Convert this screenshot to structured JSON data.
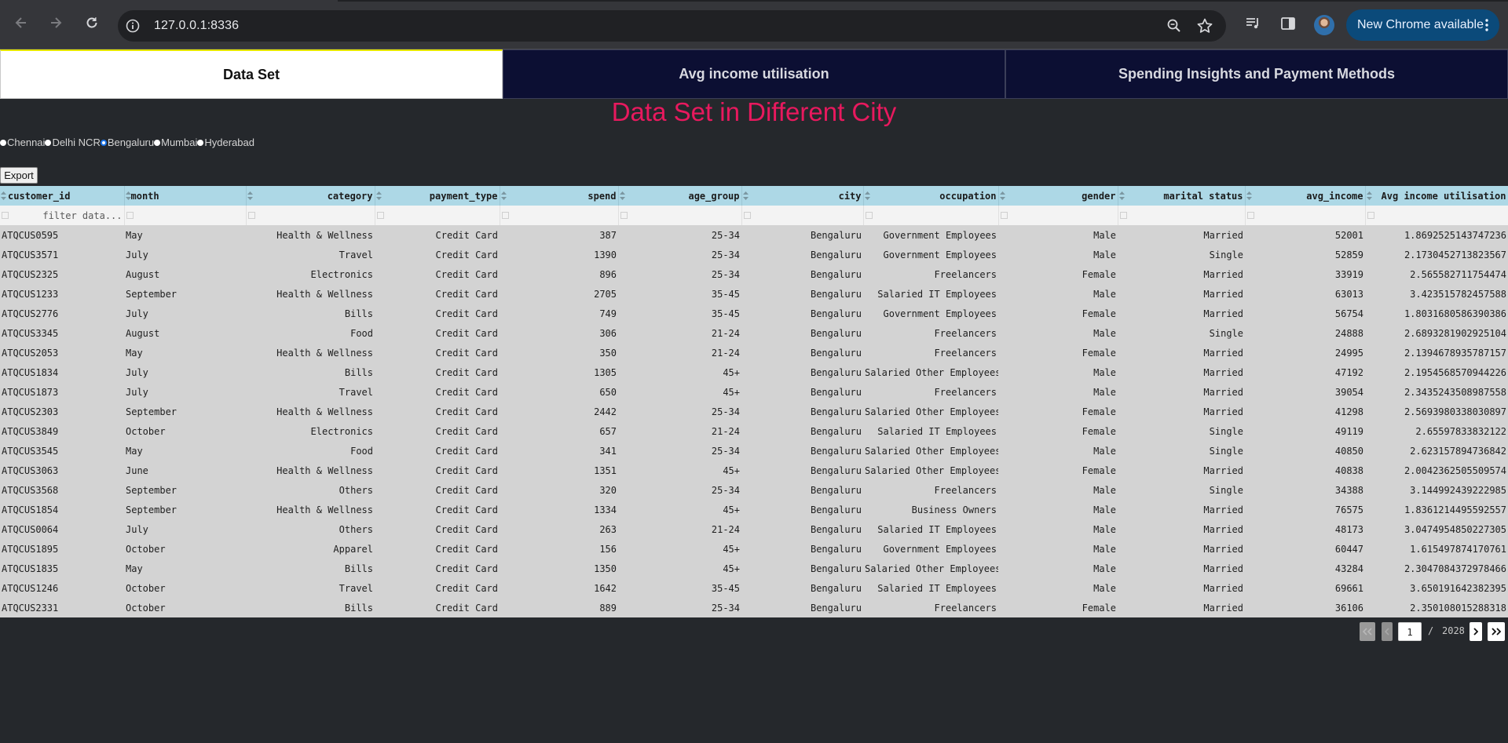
{
  "browser": {
    "url": "127.0.0.1:8336",
    "update_button": "New Chrome available"
  },
  "tabs": [
    {
      "label": "Data Set",
      "selected": true
    },
    {
      "label": "Avg income utilisation",
      "selected": false
    },
    {
      "label": "Spending Insights and Payment Methods",
      "selected": false
    }
  ],
  "title": "Data Set in Different City",
  "cities": [
    {
      "label": "Chennai",
      "selected": false
    },
    {
      "label": "Delhi NCR",
      "selected": false
    },
    {
      "label": "Bengaluru",
      "selected": true
    },
    {
      "label": "Mumbai",
      "selected": false
    },
    {
      "label": "Hyderabad",
      "selected": false
    }
  ],
  "export_label": "Export",
  "table": {
    "columns": [
      "customer_id",
      "month",
      "category",
      "payment_type",
      "spend",
      "age_group",
      "city",
      "occupation",
      "gender",
      "marital status",
      "avg_income",
      "Avg income utilisation"
    ],
    "filter_placeholder": "filter data...",
    "rows": [
      [
        "ATQCUS0595",
        "May",
        "Health & Wellness",
        "Credit Card",
        "387",
        "25-34",
        "Bengaluru",
        "Government Employees",
        "Male",
        "Married",
        "52001",
        "1.8692525143747236"
      ],
      [
        "ATQCUS3571",
        "July",
        "Travel",
        "Credit Card",
        "1390",
        "25-34",
        "Bengaluru",
        "Government Employees",
        "Male",
        "Single",
        "52859",
        "2.1730452713823567"
      ],
      [
        "ATQCUS2325",
        "August",
        "Electronics",
        "Credit Card",
        "896",
        "25-34",
        "Bengaluru",
        "Freelancers",
        "Female",
        "Married",
        "33919",
        "2.565582711754474"
      ],
      [
        "ATQCUS1233",
        "September",
        "Health & Wellness",
        "Credit Card",
        "2705",
        "35-45",
        "Bengaluru",
        "Salaried IT Employees",
        "Male",
        "Married",
        "63013",
        "3.423515782457588"
      ],
      [
        "ATQCUS2776",
        "July",
        "Bills",
        "Credit Card",
        "749",
        "35-45",
        "Bengaluru",
        "Government Employees",
        "Female",
        "Married",
        "56754",
        "1.8031680586390386"
      ],
      [
        "ATQCUS3345",
        "August",
        "Food",
        "Credit Card",
        "306",
        "21-24",
        "Bengaluru",
        "Freelancers",
        "Male",
        "Single",
        "24888",
        "2.6893281902925104"
      ],
      [
        "ATQCUS2053",
        "May",
        "Health & Wellness",
        "Credit Card",
        "350",
        "21-24",
        "Bengaluru",
        "Freelancers",
        "Female",
        "Married",
        "24995",
        "2.1394678935787157"
      ],
      [
        "ATQCUS1834",
        "July",
        "Bills",
        "Credit Card",
        "1305",
        "45+",
        "Bengaluru",
        "Salaried Other Employees",
        "Male",
        "Married",
        "47192",
        "2.1954568570944226"
      ],
      [
        "ATQCUS1873",
        "July",
        "Travel",
        "Credit Card",
        "650",
        "45+",
        "Bengaluru",
        "Freelancers",
        "Male",
        "Married",
        "39054",
        "2.3435243508987558"
      ],
      [
        "ATQCUS2303",
        "September",
        "Health & Wellness",
        "Credit Card",
        "2442",
        "25-34",
        "Bengaluru",
        "Salaried Other Employees",
        "Female",
        "Married",
        "41298",
        "2.5693980338030897"
      ],
      [
        "ATQCUS3849",
        "October",
        "Electronics",
        "Credit Card",
        "657",
        "21-24",
        "Bengaluru",
        "Salaried IT Employees",
        "Female",
        "Single",
        "49119",
        "2.65597833832122"
      ],
      [
        "ATQCUS3545",
        "May",
        "Food",
        "Credit Card",
        "341",
        "25-34",
        "Bengaluru",
        "Salaried Other Employees",
        "Male",
        "Single",
        "40850",
        "2.623157894736842"
      ],
      [
        "ATQCUS3063",
        "June",
        "Health & Wellness",
        "Credit Card",
        "1351",
        "45+",
        "Bengaluru",
        "Salaried Other Employees",
        "Female",
        "Married",
        "40838",
        "2.0042362505509574"
      ],
      [
        "ATQCUS3568",
        "September",
        "Others",
        "Credit Card",
        "320",
        "25-34",
        "Bengaluru",
        "Freelancers",
        "Male",
        "Single",
        "34388",
        "3.144992439222985"
      ],
      [
        "ATQCUS1854",
        "September",
        "Health & Wellness",
        "Credit Card",
        "1334",
        "45+",
        "Bengaluru",
        "Business Owners",
        "Male",
        "Married",
        "76575",
        "1.8361214495592557"
      ],
      [
        "ATQCUS0064",
        "July",
        "Others",
        "Credit Card",
        "263",
        "21-24",
        "Bengaluru",
        "Salaried IT Employees",
        "Male",
        "Married",
        "48173",
        "3.0474954850227305"
      ],
      [
        "ATQCUS1895",
        "October",
        "Apparel",
        "Credit Card",
        "156",
        "45+",
        "Bengaluru",
        "Government Employees",
        "Male",
        "Married",
        "60447",
        "1.615497874170761"
      ],
      [
        "ATQCUS1835",
        "May",
        "Bills",
        "Credit Card",
        "1350",
        "45+",
        "Bengaluru",
        "Salaried Other Employees",
        "Male",
        "Married",
        "43284",
        "2.3047084372978466"
      ],
      [
        "ATQCUS1246",
        "October",
        "Travel",
        "Credit Card",
        "1642",
        "35-45",
        "Bengaluru",
        "Salaried IT Employees",
        "Male",
        "Married",
        "69661",
        "3.650191642382395"
      ],
      [
        "ATQCUS2331",
        "October",
        "Bills",
        "Credit Card",
        "889",
        "25-34",
        "Bengaluru",
        "Freelancers",
        "Female",
        "Married",
        "36106",
        "2.350108015288318"
      ]
    ]
  },
  "pagination": {
    "current": "1",
    "separator": "/",
    "total": "2028"
  },
  "colors": {
    "title": "#e8195e",
    "header_bg": "#add8e6",
    "row_bg": "#d3d3d3",
    "tab_dark": "#0c0f33"
  }
}
